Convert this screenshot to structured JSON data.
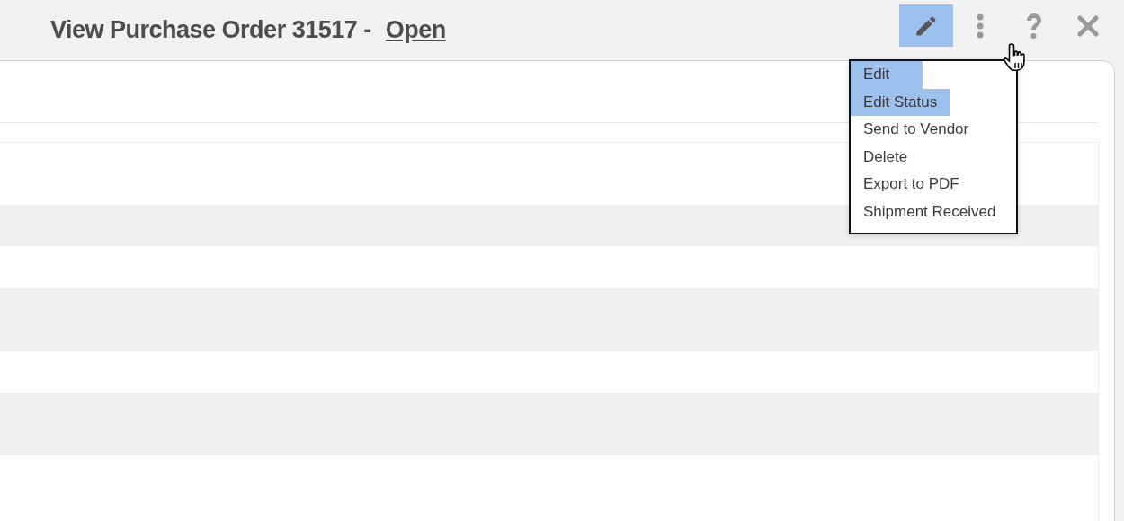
{
  "header": {
    "title": "View Purchase Order 31517 -",
    "status_link": "Open"
  },
  "toolbar": [
    {
      "kind": "edit",
      "active": true
    },
    {
      "kind": "more",
      "active": false
    },
    {
      "kind": "help",
      "active": false
    },
    {
      "kind": "close",
      "active": false
    }
  ],
  "menu": [
    {
      "label": "Edit",
      "selected": true
    },
    {
      "label": "Edit Status",
      "selected": true
    },
    {
      "label": "Send to Vendor",
      "selected": false
    },
    {
      "label": "Delete",
      "selected": false
    },
    {
      "label": "Export to PDF",
      "selected": false
    },
    {
      "label": "Shipment Received",
      "selected": false
    }
  ]
}
